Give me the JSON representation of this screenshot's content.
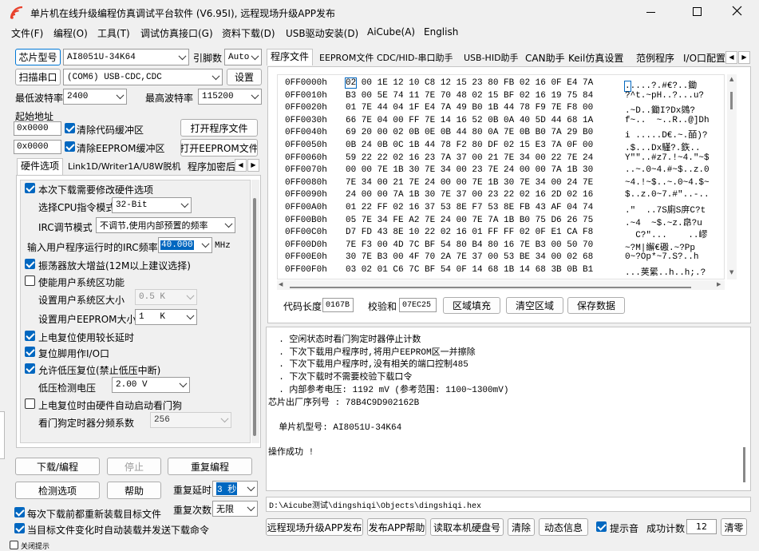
{
  "window": {
    "title": "单片机在线升级编程仿真调试平台软件 (V6.95I), 远程现场升级APP发布"
  },
  "menu": [
    "文件(F)",
    "编程(O)",
    "工具(T)",
    "调试仿真接口(G)",
    "资料下载(D)",
    "USB驱动安装(D)",
    "AiCube(A)",
    "English"
  ],
  "left": {
    "chip_button": "芯片型号",
    "chip_value": "AI8051U-34K64",
    "pins_label": "引脚数",
    "pins_value": "Auto",
    "scan_button": "扫描串口",
    "port_value": "(COM6) USB-CDC,CDC",
    "settings_button": "设置",
    "min_baud_label": "最低波特率",
    "min_baud_value": "2400",
    "max_baud_label": "最高波特率",
    "max_baud_value": "115200",
    "start_addr_label": "起始地址",
    "addr1": "0x0000",
    "clear_code_label": "清除代码缓冲区",
    "open_program_button": "打开程序文件",
    "addr2": "0x0000",
    "clear_eeprom_label": "清除EEPROM缓冲区",
    "open_eeprom_button": "打开EEPROM文件",
    "subtabs": [
      "硬件选项",
      "Link1D/Writer1A/U8W脱机",
      "程序加密后"
    ],
    "options": {
      "modify_hw": "本次下载需要修改硬件选项",
      "cpu_mode_label": "选择CPU指令模式",
      "cpu_mode_value": "32-Bit",
      "irc_mode_label": "IRC调节模式",
      "irc_mode_value": "不调节,使用内部预置的频率",
      "irc_freq_label": "输入用户程序运行时的IRC频率",
      "irc_freq_value": "40.000",
      "irc_freq_unit": "MHz",
      "osc_gain": "振荡器放大增益(12M以上建议选择)",
      "user_sys_area": "使能用户系统区功能",
      "sys_area_size_label": "设置用户系统区大小",
      "sys_area_size_value": "0.5 K",
      "eeprom_size_label": "设置用户EEPROM大小",
      "eeprom_size_value": "1   K",
      "long_delay": "上电复位使用较长延时",
      "reset_io": "复位脚用作I/O口",
      "low_volt_reset": "允许低压复位(禁止低压中断)",
      "low_volt_label": "低压检测电压",
      "low_volt_value": "2.00 V",
      "wdt_hw": "上电复位时由硬件自动启动看门狗",
      "wdt_div_label": "看门狗定时器分频系数",
      "wdt_div_value": "256"
    },
    "download_button": "下载/编程",
    "stop_button": "停止",
    "reprogram_button": "重复编程",
    "detect_button": "检测选项",
    "help_button": "帮助",
    "repeat_delay_label": "重复延时",
    "repeat_delay_value": "3 秒",
    "repeat_count_label": "重复次数",
    "repeat_count_value": "无限",
    "reload_label": "每次下载前都重新装载目标文件",
    "auto_send_label": "当目标文件变化时自动装载并发送下载命令",
    "offline_label": "关闭提示"
  },
  "right": {
    "tabs": [
      "程序文件",
      "EEPROM文件",
      "CDC/HID-串口助手",
      "USB-HID助手",
      "CAN助手",
      "Keil仿真设置",
      "范例程序",
      "I/O口配置"
    ],
    "hex_rows": [
      {
        "addr": "0FF0000h",
        "hex": "02 00 1E 12 10 C8 12 15 23 80 FB 02 16 0F E4 7A",
        "ascii": ".....?.#€?..鋤"
      },
      {
        "addr": "0FF0010h",
        "hex": "B3 00 5E 74 11 7E 70 48 02 15 BF 02 16 19 75 84",
        "ascii": "?^t.~pH..?...u?"
      },
      {
        "addr": "0FF0020h",
        "hex": "01 7E 44 04 1F E4 7A 49 B0 1B 44 78 F9 7E F8 00",
        "ascii": ".~D..鋤I?Dx鵕?"
      },
      {
        "addr": "0FF0030h",
        "hex": "66 7E 04 00 FF 7E 14 16 52 0B 0A 40 5D 44 68 1A",
        "ascii": "f~..  ~..R..@]Dh"
      },
      {
        "addr": "0FF0040h",
        "hex": "69 20 00 02 0B 0E 0B 44 80 0A 7E 0B B0 7A 29 B0",
        "ascii": "i .....D€.~.皕)?"
      },
      {
        "addr": "0FF0050h",
        "hex": "0B 24 0B 0C 1B 44 78 F2 80 DF 02 15 E3 7A 0F 00",
        "ascii": ".$...Dx騹?.鉃.."
      },
      {
        "addr": "0FF0060h",
        "hex": "59 22 22 02 16 23 7A 37 00 21 7E 34 00 22 7E 24",
        "ascii": "Y\"\"..#z7.!~4.\"~$"
      },
      {
        "addr": "0FF0070h",
        "hex": "00 00 7E 1B 30 7E 34 00 23 7E 24 00 00 7A 1B 30",
        "ascii": "..~.0~4.#~$..z.0"
      },
      {
        "addr": "0FF0080h",
        "hex": "7E 34 00 21 7E 24 00 00 7E 1B 30 7E 34 00 24 7E",
        "ascii": "~4.!~$..~.0~4.$~"
      },
      {
        "addr": "0FF0090h",
        "hex": "24 00 00 7A 1B 30 7E 37 00 23 22 02 16 2D 02 16",
        "ascii": "$..z.0~7.#\"..-.."
      },
      {
        "addr": "0FF00A0h",
        "hex": "01 22 FF 02 16 37 53 8E F7 53 8E FB 43 AF 04 74",
        "ascii": ".\"  ..7S廁S庰C?t"
      },
      {
        "addr": "0FF00B0h",
        "hex": "05 7E 34 FE A2 7E 24 00 7E 7A 1B B0 75 D6 26 75",
        "ascii": ".~4  ~$.~z.皍?u"
      },
      {
        "addr": "0FF00C0h",
        "hex": "D7 FD 43 8E 10 22 02 16 01 FF FF 02 0F E1 CA F8",
        "ascii": "  C?\"...    ..嵺"
      },
      {
        "addr": "0FF00D0h",
        "hex": "7E F3 00 4D 7C BF 54 80 B4 80 16 7E B3 00 50 70",
        "ascii": "~?M|繲€磤.~?Pp"
      },
      {
        "addr": "0FF00E0h",
        "hex": "30 7E B3 00 4F 70 2A 7E 37 00 53 BE 34 00 02 68",
        "ascii": "0~?Op*~7.S?..h"
      },
      {
        "addr": "0FF00F0h",
        "hex": "03 02 01 C6 7C BF 54 0F 14 68 1B 14 68 3B 0B B1",
        "ascii": "...荚綤..h..h;.?"
      }
    ],
    "code_len_label": "代码长度",
    "code_len_value": "0167B",
    "checksum_label": "校验和",
    "checksum_value": "07EC25",
    "fill_button": "区域填充",
    "clear_area_button": "清空区域",
    "save_button": "保存数据",
    "log": [
      "  . 空闲状态时看门狗定时器停止计数",
      "  . 下次下载用户程序时,将用户EEPROM区一并擦除",
      "  . 下次下载用户程序时,没有相关的端口控制485",
      "  . 下次下载时不需要校验下载口令",
      "  . 内部参考电压: 1192 mV (参考范围: 1100~1300mV)",
      "芯片出厂序列号 : 78B4C9D902162B",
      "",
      "  单片机型号: AI8051U-34K64",
      "",
      "操作成功 !"
    ],
    "file_path": "D:\\Aicube测试\\dingshiqi\\Objects\\dingshiqi.hex",
    "publish_button": "远程现场升级APP发布",
    "publish_help_button": "发布APP帮助",
    "read_disk_button": "读取本机硬盘号",
    "clear_button": "清除",
    "animation_button": "动态信息",
    "beep_label": "提示音",
    "success_label": "成功计数",
    "success_value": "12",
    "reset_count_button": "清零"
  },
  "colors": {
    "accent": "#0067c0",
    "title_icon": "#e8412c"
  }
}
